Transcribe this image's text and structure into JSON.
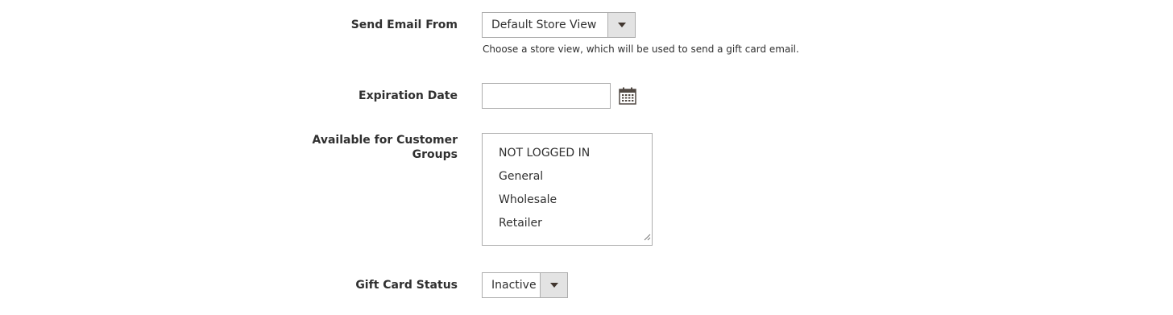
{
  "send_email_from": {
    "label": "Send Email From",
    "selected": "Default Store View",
    "note": "Choose a store view, which will be used to send a gift card email."
  },
  "expiration_date": {
    "label": "Expiration Date",
    "value": "",
    "icon": "calendar-icon"
  },
  "customer_groups": {
    "label_line1": "Available for Customer",
    "label_line2": "Groups",
    "options": [
      "NOT LOGGED IN",
      "General",
      "Wholesale",
      "Retailer"
    ]
  },
  "gift_card_status": {
    "label": "Gift Card Status",
    "selected": "Inactive"
  },
  "colors": {
    "border": "#adadad",
    "arrow_bg": "#e3e3e3",
    "text": "#303030"
  }
}
